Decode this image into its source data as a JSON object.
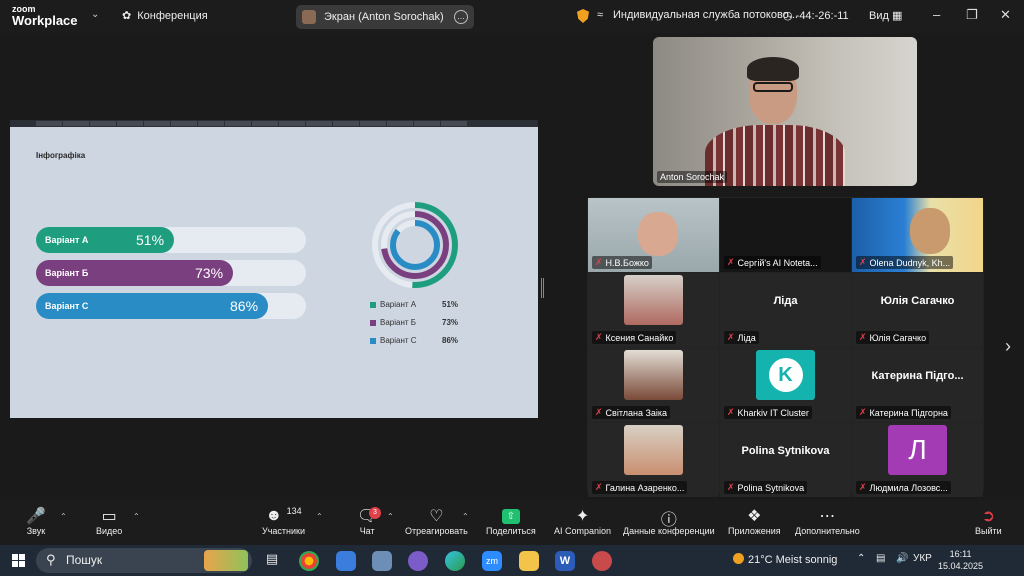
{
  "topbar": {
    "logo_line1": "zoom",
    "logo_line2": "Workplace",
    "conference_label": "Конференция",
    "share_label": "Экран (Anton Sorochak)",
    "stream_label": "Индивидуальная служба потоково...",
    "timer": "-44:-26:-11",
    "view_label": "Вид",
    "colors": {
      "warning": "#f0a020"
    }
  },
  "slide": {
    "title": "Інфографіка",
    "chart_data": {
      "type": "bar",
      "categories": [
        "Варіант А",
        "Варіант Б",
        "Варіант С"
      ],
      "values": [
        51,
        73,
        86
      ],
      "value_labels": [
        "51%",
        "73%",
        "86%"
      ],
      "colors": [
        "#1f9e7f",
        "#7a3f7f",
        "#2a8cc4"
      ],
      "xlim": [
        0,
        100
      ],
      "legend": [
        {
          "name": "Варіант А",
          "value": "51%"
        },
        {
          "name": "Варіант Б",
          "value": "73%"
        },
        {
          "name": "Варіант С",
          "value": "86%"
        }
      ]
    }
  },
  "speaker": {
    "name": "Anton Sorochak"
  },
  "participants": [
    {
      "name": "Н.В.Божко",
      "big": ""
    },
    {
      "name": "Сергій's AI Noteta...",
      "big": ""
    },
    {
      "name": "Olena Dudnyk, Kh...",
      "big": ""
    },
    {
      "name": "Ксения Санайко",
      "big": ""
    },
    {
      "name": "Ліда",
      "big": "Ліда"
    },
    {
      "name": "Юлія Сагачко",
      "big": "Юлія Сагачко"
    },
    {
      "name": "Світлана Заіка",
      "big": ""
    },
    {
      "name": "Kharkiv IT Cluster",
      "big": ""
    },
    {
      "name": "Катерина Підгорна",
      "big": "Катерина Підго..."
    },
    {
      "name": "Галина Азаренко...",
      "big": ""
    },
    {
      "name": "Polina Sytnikova",
      "big": "Polina Sytnikova"
    },
    {
      "name": "Людмила Лозовс...",
      "big": ""
    }
  ],
  "avatar_letter": "Л",
  "toolbar": {
    "audio": "Звук",
    "video": "Видео",
    "participants": "Участники",
    "participants_count": "134",
    "chat": "Чат",
    "chat_badge": "3",
    "react": "Отреагировать",
    "share": "Поделиться",
    "ai": "AI Companion",
    "info": "Данные конференции",
    "apps": "Приложения",
    "more": "Дополнительно",
    "leave": "Выйти"
  },
  "taskbar": {
    "search_placeholder": "Пошук",
    "weather": "21°C  Meist sonnig",
    "lang": "УКР",
    "time": "16:11",
    "date": "15.04.2025"
  }
}
